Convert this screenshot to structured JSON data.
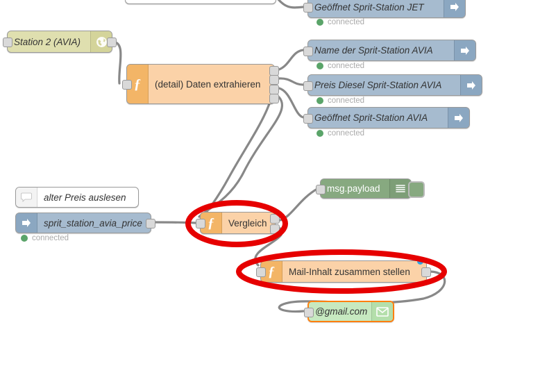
{
  "app": {
    "name": "Node-RED flow editor",
    "canvas_background": "#ffffff",
    "wire_color": "#888888",
    "annotation_color": "#e60000"
  },
  "nodes": [
    {
      "id": "partial_top",
      "name": "partial-node-top",
      "label": "",
      "type": "unknown",
      "note": "node cut off by top edge of viewport"
    },
    {
      "id": "geoeffnet_jet",
      "name": "node-geoeffnet-sprit-station-jet",
      "label": "Geöffnet Sprit-Station JET",
      "type": "mqtt-out",
      "icon": "arrow-right-icon",
      "color": "#a6bbcf",
      "status": "connected",
      "status_color": "#5aa469"
    },
    {
      "id": "station2_avia",
      "name": "node-station-2-avia",
      "label": "Station 2 (AVIA)",
      "type": "http-request",
      "icon": "globe-icon",
      "color": "#dfdfaf",
      "status": null
    },
    {
      "id": "daten_extrahieren",
      "name": "node-detail-daten-extrahieren",
      "label": "(detail) Daten extrahieren",
      "type": "function",
      "icon": "function-f-icon",
      "color": "#f3b567",
      "outputs": 4,
      "status": null
    },
    {
      "id": "name_avia",
      "name": "node-name-der-sprit-station-avia",
      "label": "Name der Sprit-Station AVIA",
      "type": "mqtt-out",
      "icon": "arrow-right-icon",
      "color": "#a6bbcf",
      "status": "connected",
      "status_color": "#5aa469"
    },
    {
      "id": "preis_diesel_avia",
      "name": "node-preis-diesel-sprit-station-avia",
      "label": "Preis Diesel Sprit-Station AVIA",
      "type": "mqtt-out",
      "icon": "arrow-right-icon",
      "color": "#a6bbcf",
      "status": "connected",
      "status_color": "#5aa469"
    },
    {
      "id": "geoeffnet_avia",
      "name": "node-geoeffnet-sprit-station-avia",
      "label": "Geöffnet Sprit-Station AVIA",
      "type": "mqtt-out",
      "icon": "arrow-right-icon",
      "color": "#a6bbcf",
      "status": "connected",
      "status_color": "#5aa469"
    },
    {
      "id": "comment_alter_preis",
      "name": "node-comment-alter-preis-auslesen",
      "label": "alter Preis auslesen",
      "type": "comment",
      "icon": "comment-bubble-icon",
      "color": "#ffffff",
      "status": null
    },
    {
      "id": "sprit_station_avia_price",
      "name": "node-sprit-station-avia-price",
      "label": "sprit_station_avia_price",
      "type": "mqtt-in",
      "icon": "arrow-right-icon",
      "color": "#a6bbcf",
      "status": "connected",
      "status_color": "#5aa469"
    },
    {
      "id": "debug_payload",
      "name": "node-debug-msg-payload",
      "label": "msg.payload",
      "type": "debug",
      "icon": "debug-lines-icon",
      "color": "#87a980",
      "status": null
    },
    {
      "id": "vergleich",
      "name": "node-vergleich",
      "label": "Vergleich",
      "type": "function",
      "icon": "function-f-icon",
      "color": "#f3b567",
      "outputs": 2,
      "highlighted": true,
      "status": null
    },
    {
      "id": "mail_inhalt",
      "name": "node-mail-inhalt-zusammen-stellen",
      "label": "Mail-Inhalt zusammen stellen",
      "type": "function",
      "icon": "function-f-icon",
      "color": "#f3b567",
      "outputs": 1,
      "highlighted": true,
      "changed_indicator": true,
      "status": null
    },
    {
      "id": "gmail",
      "name": "node-gmail",
      "label": "@gmail.com",
      "type": "e-mail",
      "icon": "envelope-icon",
      "color": "#c7e9c0",
      "selected": true,
      "status": null
    }
  ],
  "annotations": [
    {
      "name": "annotation-ellipse-vergleich",
      "shape": "ellipse",
      "color": "#e60000",
      "targets": "Vergleich"
    },
    {
      "name": "annotation-ellipse-mail-inhalt",
      "shape": "ellipse",
      "color": "#e60000",
      "targets": "Mail-Inhalt zusammen stellen"
    }
  ],
  "status_labels": {
    "connected": "connected"
  }
}
